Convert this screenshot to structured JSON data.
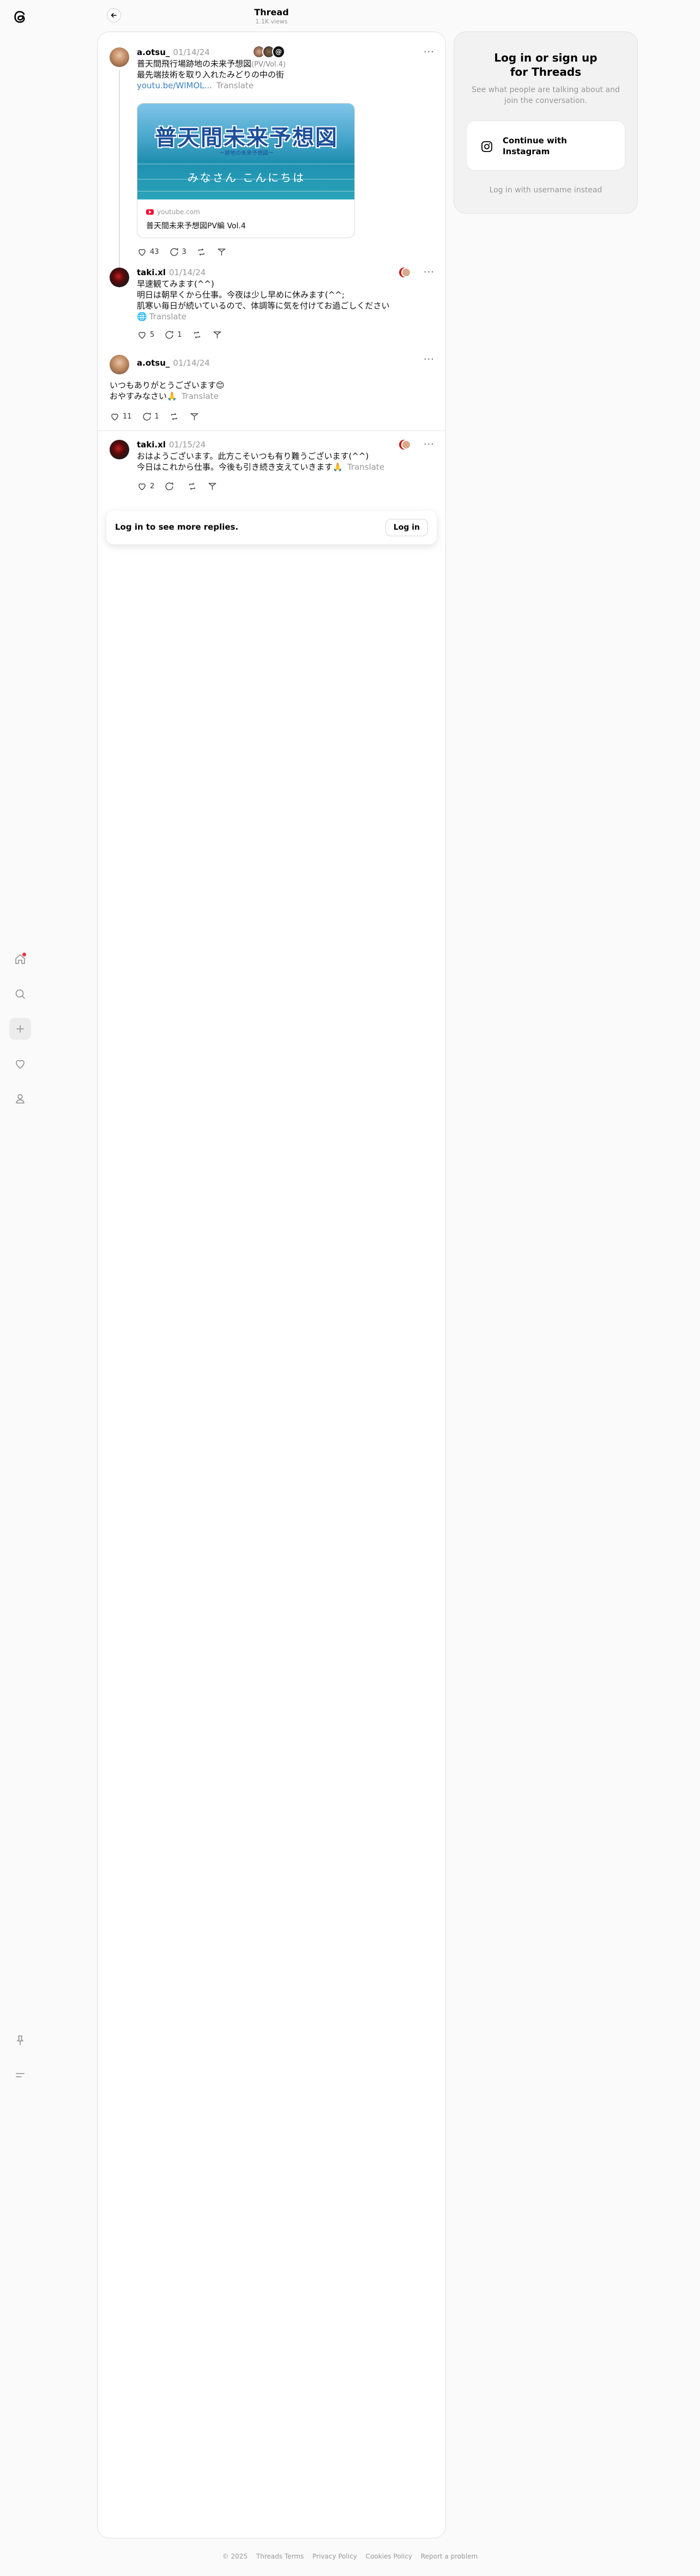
{
  "header": {
    "title": "Thread",
    "views": "1.1K views",
    "back_icon": "arrow-left-icon"
  },
  "sidebar": {
    "logo": "threads-logo",
    "items": [
      {
        "icon": "home-icon",
        "label": "Home"
      },
      {
        "icon": "search-icon",
        "label": "Search"
      },
      {
        "icon": "plus-icon",
        "label": "Create"
      },
      {
        "icon": "heart-icon",
        "label": "Activity"
      },
      {
        "icon": "profile-icon",
        "label": "Profile"
      }
    ],
    "bottom": [
      {
        "icon": "pin-icon",
        "label": "Pinned"
      },
      {
        "icon": "menu-icon",
        "label": "More"
      }
    ],
    "notification_color": "#ff3040"
  },
  "posts": [
    {
      "username": "a.otsu_",
      "date": "01/14/24",
      "text_line1": "普天間飛行場跡地の未来予想図",
      "text_line1_suffix": "(PV/Vol.4)",
      "text_line2": "最先端技術を取り入れたみどりの中の街",
      "link": "youtu.be/WlMOL...",
      "translate": "Translate",
      "preview": {
        "title": "普天間未来予想図",
        "subtitle": "ー跡地の未来予想図ー",
        "greeting": "みなさん こんにちは",
        "source": "youtube.com",
        "caption": "普天間未来予想図PV編 Vol.4"
      },
      "likes": "43",
      "replies": "3"
    },
    {
      "username": "taki.xl",
      "date": "01/14/24",
      "lines": [
        "早速観てみます(^^)",
        "明日は朝早くから仕事。今夜は少し早めに休みます(^^;",
        "肌寒い毎日が続いているので、体調等に気を付けてお過ごしください"
      ],
      "translate": "Translate",
      "likes": "5",
      "replies": "1"
    },
    {
      "username": "a.otsu_",
      "date": "01/14/24",
      "lines": [
        "いつもありがとうございます😊",
        "おやすみなさい🙏"
      ],
      "translate": "Translate",
      "likes": "11",
      "replies": "1"
    },
    {
      "username": "taki.xl",
      "date": "01/15/24",
      "lines": [
        "おはようございます。此方こそいつも有り難うございます(^^)",
        "今日はこれから仕事。今後も引き続き支えていきます🙏"
      ],
      "translate": "Translate",
      "likes": "2",
      "replies": ""
    }
  ],
  "login_bar": {
    "text": "Log in to see more replies.",
    "button": "Log in"
  },
  "right_card": {
    "title": "Log in or sign up\nfor Threads",
    "subtitle": "See what people are talking about and join the conversation.",
    "button": "Continue with\nInstagram",
    "alt": "Log in with username instead"
  },
  "footer": {
    "items": [
      "© 2025",
      "Threads Terms",
      "Privacy Policy",
      "Cookies Policy",
      "Report a problem"
    ]
  }
}
